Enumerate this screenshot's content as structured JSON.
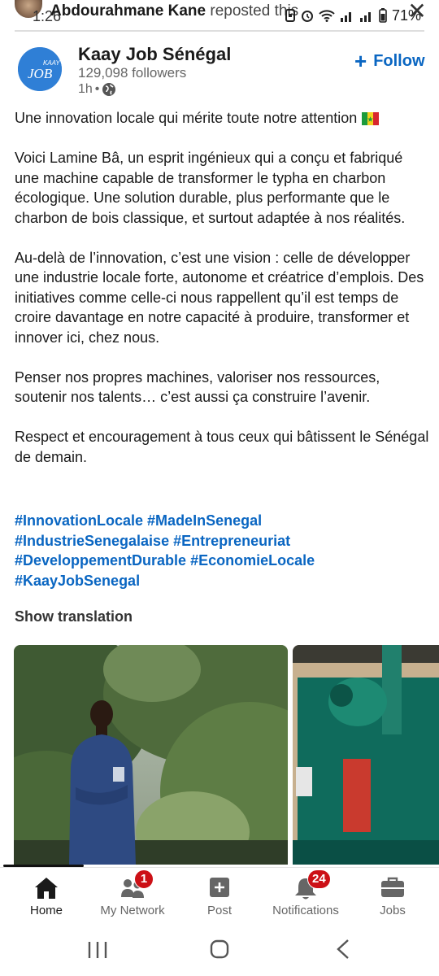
{
  "status_bar": {
    "time": "1:26",
    "battery": "71%"
  },
  "repost": {
    "name": "Abdourahmane Kane",
    "action": "reposted this"
  },
  "company": {
    "name": "Kaay Job Sénégal",
    "followers": "129,098 followers",
    "time_ago": "1h",
    "logo_text_top": "KAAY",
    "logo_text_bottom": "JOB"
  },
  "follow_button": {
    "label": "Follow"
  },
  "post": {
    "paragraphs": [
      "Une innovation locale qui mérite toute notre attention",
      "Voici Lamine Bâ, un esprit ingénieux qui a conçu et fabriqué une machine capable de transformer le typha en charbon écologique. Une solution durable, plus performante que le charbon de bois classique, et surtout adaptée à nos réalités.",
      "Au-delà de l’innovation, c’est une vision : celle de développer une industrie locale forte, autonome et créatrice d’emplois. Des initiatives comme celle-ci nous rappellent qu’il est temps de croire davantage en notre capacité à produire, transformer et innover ici, chez nous.",
      "Penser nos propres machines, valoriser nos ressources, soutenir nos talents… c’est aussi ça construire l’avenir.",
      "Respect et encouragement à tous ceux qui bâtissent le Sénégal de demain."
    ],
    "hashtags": [
      "#InnovationLocale",
      "#MadeInSenegal",
      "#IndustrieSenegalaise",
      "#Entrepreneuriat",
      "#DeveloppementDurable",
      "#EconomieLocale",
      "#KaayJobSenegal"
    ],
    "show_translation": "Show translation"
  },
  "nav": {
    "items": [
      {
        "label": "Home",
        "icon": "home-icon",
        "active": true
      },
      {
        "label": "My Network",
        "icon": "network-icon",
        "badge": "1"
      },
      {
        "label": "Post",
        "icon": "post-icon"
      },
      {
        "label": "Notifications",
        "icon": "bell-icon",
        "badge": "24"
      },
      {
        "label": "Jobs",
        "icon": "briefcase-icon"
      }
    ]
  },
  "colors": {
    "accent": "#0a66c2",
    "badge": "#cc1016",
    "logo_bg": "#2f7fd6"
  }
}
